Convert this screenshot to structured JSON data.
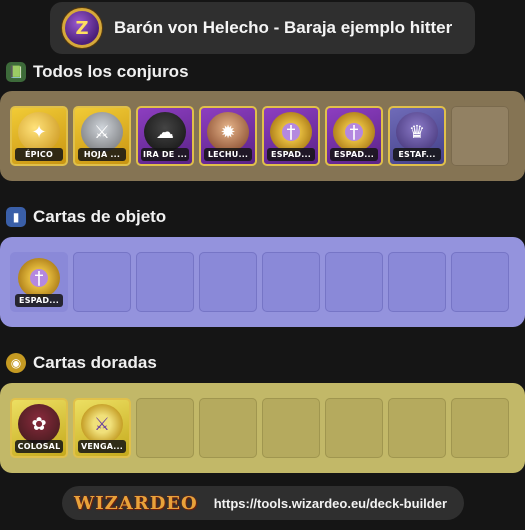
{
  "header": {
    "title": "Barón von Helecho - Baraja ejemplo hitter",
    "school_icon": "storm-school-icon",
    "school_glyph": "Z"
  },
  "sections": {
    "spells": {
      "title": "Todos los conjuros",
      "icon": "spellbook-icon",
      "cards": [
        {
          "name": "ÉPICO",
          "icon": "epic-rock-icon"
        },
        {
          "name": "HOJA ...",
          "icon": "sword-icon"
        },
        {
          "name": "IRA DE ...",
          "icon": "wrath-icon"
        },
        {
          "name": "LECHU...",
          "icon": "owl-icon"
        },
        {
          "name": "ESPAD...",
          "icon": "sword-orb-icon"
        },
        {
          "name": "ESPAD...",
          "icon": "sword-orb-icon"
        },
        {
          "name": "ESTAF...",
          "icon": "wizard-icon"
        }
      ]
    },
    "items": {
      "title": "Cartas de objeto",
      "icon": "item-card-icon",
      "cards": [
        {
          "name": "ESPAD...",
          "icon": "sword-orb-icon"
        }
      ]
    },
    "gold": {
      "title": "Cartas doradas",
      "icon": "gold-card-icon",
      "cards": [
        {
          "name": "COLOSAL",
          "icon": "colossal-icon"
        },
        {
          "name": "VENGA...",
          "icon": "dagger-icon"
        }
      ]
    }
  },
  "footer": {
    "logo": "WIZARDEO",
    "url": "https://tools.wizardeo.eu/deck-builder"
  }
}
